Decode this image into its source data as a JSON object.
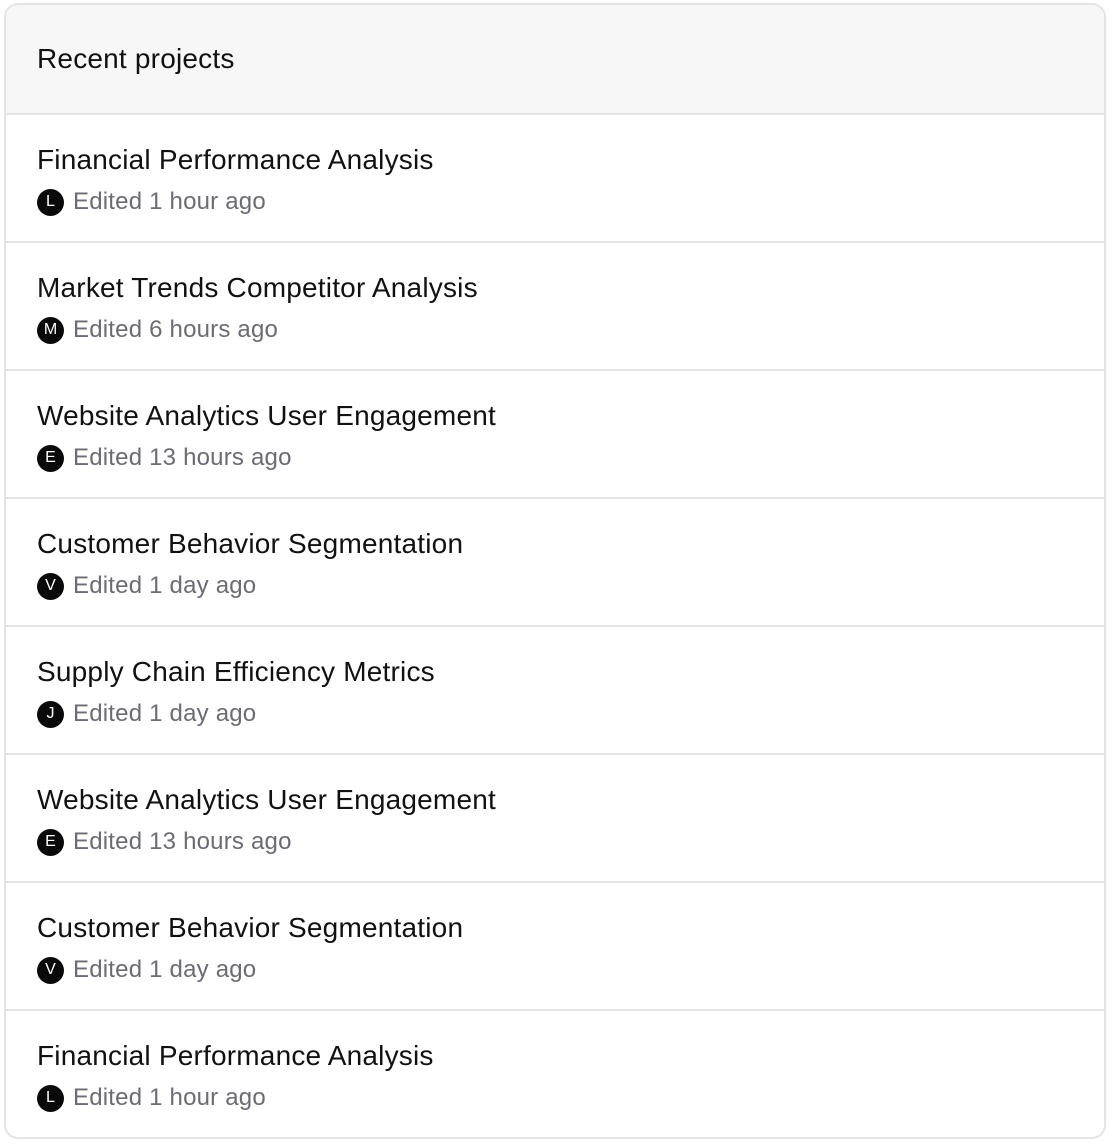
{
  "header": {
    "title": "Recent projects"
  },
  "projects": [
    {
      "name": "Financial Performance Analysis",
      "avatar_initial": "L",
      "edited": "Edited 1 hour ago"
    },
    {
      "name": "Market Trends Competitor Analysis",
      "avatar_initial": "M",
      "edited": "Edited 6 hours ago"
    },
    {
      "name": "Website Analytics User Engagement",
      "avatar_initial": "E",
      "edited": "Edited 13 hours ago"
    },
    {
      "name": "Customer Behavior Segmentation",
      "avatar_initial": "V",
      "edited": "Edited 1 day ago"
    },
    {
      "name": "Supply Chain Efficiency Metrics",
      "avatar_initial": "J",
      "edited": "Edited 1 day ago"
    },
    {
      "name": "Website Analytics User Engagement",
      "avatar_initial": "E",
      "edited": "Edited 13 hours ago"
    },
    {
      "name": "Customer Behavior Segmentation",
      "avatar_initial": "V",
      "edited": "Edited 1 day ago"
    },
    {
      "name": "Financial Performance Analysis",
      "avatar_initial": "L",
      "edited": "Edited 1 hour ago"
    }
  ],
  "colors": {
    "header_bg": "#f7f7f8",
    "border": "#e4e4e7",
    "avatar_bg": "#0a0a0a",
    "meta_text": "#6b6b73"
  }
}
